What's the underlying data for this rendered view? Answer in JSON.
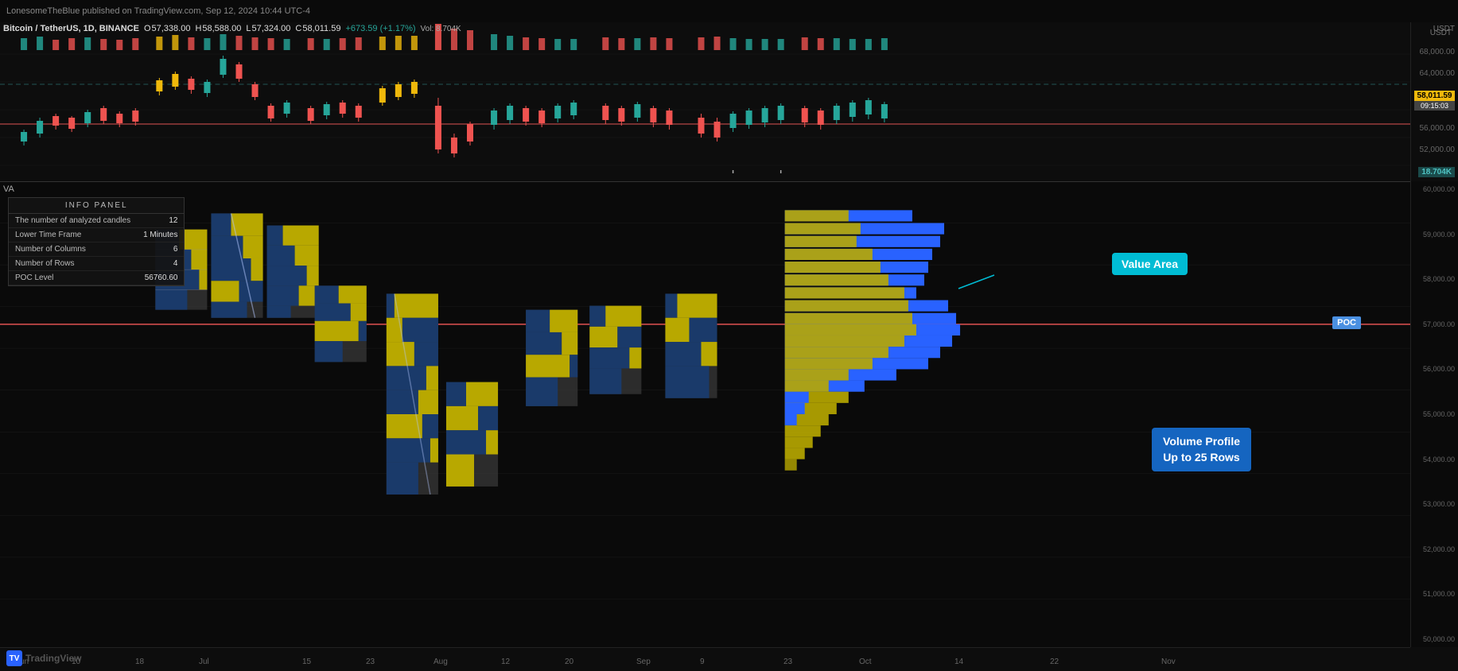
{
  "publisher": "LonesomeTheBlue published on TradingView.com, Sep 12, 2024 10:44 UTC-4",
  "header": {
    "symbol": "Bitcoin / TetherUS",
    "timeframe": "1D",
    "exchange": "BINANCE",
    "open_label": "O",
    "open_value": "57,338.00",
    "high_label": "H",
    "high_value": "58,588.00",
    "low_label": "L",
    "low_value": "57,324.00",
    "close_label": "C",
    "close_value": "58,011.59",
    "change": "+673.59 (+1.17%)",
    "vol_label": "Vol",
    "vol_value": "8.704K"
  },
  "price_axis_top": [
    "68,000.00",
    "64,000.00",
    "60,000.00",
    "56,000.00",
    "52,000.00"
  ],
  "price_axis_bottom": [
    "60,000.00",
    "59,000.00",
    "58,000.00",
    "57,000.00",
    "56,000.00",
    "55,000.00",
    "54,000.00",
    "53,000.00",
    "52,000.00",
    "51,000.00",
    "50,000.00"
  ],
  "current_price": "58,011.59",
  "current_time": "09:15:03",
  "vol_badge": "18.704K",
  "usdt_label": "USDT",
  "va_label": "VA",
  "poc_label": "POC",
  "value_area_label": "Value Area",
  "volume_profile_label": "Volume Profile\nUp to 25 Rows",
  "poc_level": "57,000.00",
  "time_labels": [
    "Jun",
    "10",
    "18",
    "Jul",
    "15",
    "23",
    "Aug",
    "12",
    "20",
    "Sep",
    "9",
    "23",
    "Oct",
    "14",
    "22",
    "Nov"
  ],
  "info_panel": {
    "title": "INFO PANEL",
    "rows": [
      {
        "label": "The number of analyzed candles",
        "value": "12"
      },
      {
        "label": "Lower Time Frame",
        "value": "1 Minutes"
      },
      {
        "label": "Number of Columns",
        "value": "6"
      },
      {
        "label": "Number of Rows",
        "value": "4"
      },
      {
        "label": "POC Level",
        "value": "56760.60"
      }
    ]
  },
  "tv_logo_text": "TradingView"
}
